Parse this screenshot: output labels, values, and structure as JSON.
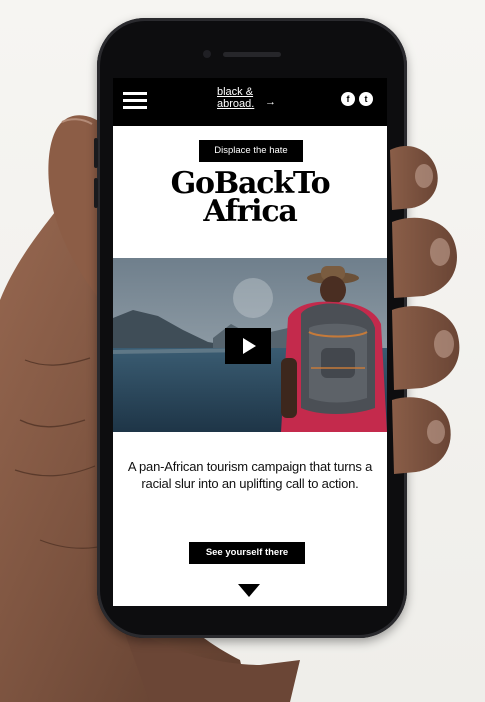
{
  "nav": {
    "logo_line1": "black &",
    "logo_line2": "abroad.",
    "menu_icon": "hamburger-icon",
    "social": [
      {
        "icon": "facebook-icon",
        "glyph": "f"
      },
      {
        "icon": "twitter-icon",
        "glyph": "t"
      }
    ]
  },
  "hero": {
    "tag": "Displace the hate",
    "headline_line1": "GoBackTo",
    "headline_line2": "Africa"
  },
  "video": {
    "play_icon": "play-icon"
  },
  "body": {
    "tagline": "A pan-African tourism campaign that turns a racial slur into an uplifting call to action."
  },
  "cta": {
    "label": "See yourself there",
    "scroll_icon": "down-arrow-icon"
  },
  "colors": {
    "primary": "#000000",
    "screen_bg": "#ffffff",
    "phone_body": "#0d0d0f"
  }
}
